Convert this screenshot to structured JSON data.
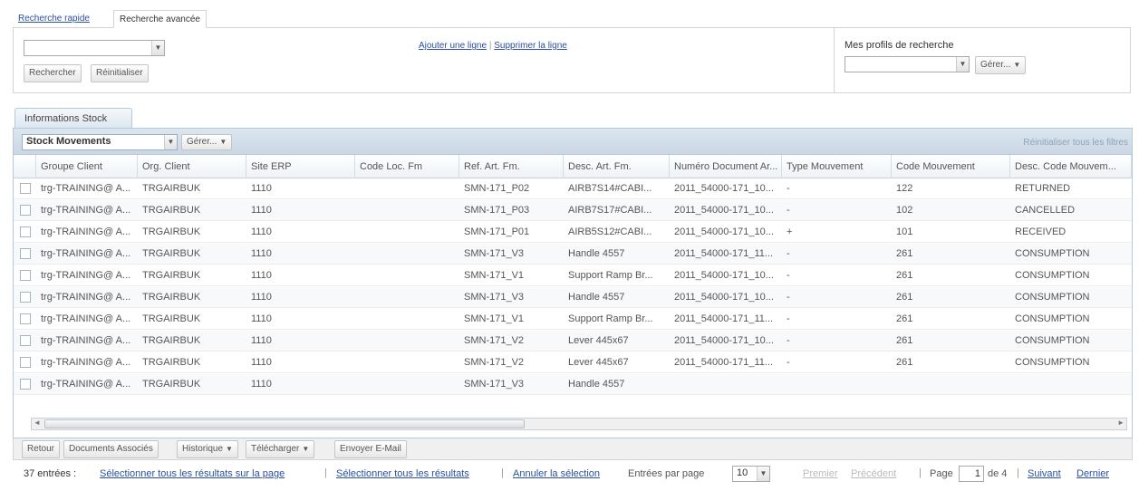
{
  "search_tabs": {
    "quick": "Recherche rapide",
    "advanced": "Recherche avancée"
  },
  "search": {
    "search_button": "Rechercher",
    "reset_button": "Réinitialiser",
    "add_line": "Ajouter une ligne",
    "separator": "|",
    "remove_line": "Supprimer la ligne",
    "profiles_title": "Mes profils de recherche",
    "manage_button": "Gérer..."
  },
  "results": {
    "tab_label": "Informations Stock",
    "view_select": "Stock Movements",
    "manage_button": "Gérer...",
    "reset_filters": "Réinitialiser tous les filtres"
  },
  "table": {
    "columns": [
      "Groupe Client",
      "Org. Client",
      "Site ERP",
      "Code Loc. Fm",
      "Ref. Art. Fm.",
      "Desc. Art. Fm.",
      "Numéro Document Ar...",
      "Type Mouvement",
      "Code Mouvement",
      "Desc. Code Mouvem..."
    ],
    "rows": [
      [
        "trg-TRAINING@ A...",
        "TRGAIRBUK",
        "1110",
        "",
        "SMN-171_P02",
        "AIRB7S14#CABI...",
        "2011_54000-171_10...",
        "-",
        "122",
        "RETURNED"
      ],
      [
        "trg-TRAINING@ A...",
        "TRGAIRBUK",
        "1110",
        "",
        "SMN-171_P03",
        "AIRB7S17#CABI...",
        "2011_54000-171_10...",
        "-",
        "102",
        "CANCELLED"
      ],
      [
        "trg-TRAINING@ A...",
        "TRGAIRBUK",
        "1110",
        "",
        "SMN-171_P01",
        "AIRB5S12#CABI...",
        "2011_54000-171_10...",
        "+",
        "101",
        "RECEIVED"
      ],
      [
        "trg-TRAINING@ A...",
        "TRGAIRBUK",
        "1110",
        "",
        "SMN-171_V3",
        "Handle 4557",
        "2011_54000-171_11...",
        "-",
        "261",
        "CONSUMPTION"
      ],
      [
        "trg-TRAINING@ A...",
        "TRGAIRBUK",
        "1110",
        "",
        "SMN-171_V1",
        "Support Ramp Br...",
        "2011_54000-171_10...",
        "-",
        "261",
        "CONSUMPTION"
      ],
      [
        "trg-TRAINING@ A...",
        "TRGAIRBUK",
        "1110",
        "",
        "SMN-171_V3",
        "Handle 4557",
        "2011_54000-171_10...",
        "-",
        "261",
        "CONSUMPTION"
      ],
      [
        "trg-TRAINING@ A...",
        "TRGAIRBUK",
        "1110",
        "",
        "SMN-171_V1",
        "Support Ramp Br...",
        "2011_54000-171_11...",
        "-",
        "261",
        "CONSUMPTION"
      ],
      [
        "trg-TRAINING@ A...",
        "TRGAIRBUK",
        "1110",
        "",
        "SMN-171_V2",
        "Lever 445x67",
        "2011_54000-171_10...",
        "-",
        "261",
        "CONSUMPTION"
      ],
      [
        "trg-TRAINING@ A...",
        "TRGAIRBUK",
        "1110",
        "",
        "SMN-171_V2",
        "Lever 445x67",
        "2011_54000-171_11...",
        "-",
        "261",
        "CONSUMPTION"
      ],
      [
        "trg-TRAINING@ A...",
        "TRGAIRBUK",
        "1110",
        "",
        "SMN-171_V3",
        "Handle 4557",
        "",
        "",
        "",
        ""
      ]
    ]
  },
  "actions": {
    "back": "Retour",
    "associated_docs": "Documents Associés",
    "history": "Historique",
    "download": "Télécharger",
    "send_email": "Envoyer E-Mail"
  },
  "pager": {
    "entries": "37 entrées :",
    "select_page": "Sélectionner tous les résultats sur la page",
    "select_all": "Sélectionner tous les résultats",
    "cancel_selection": "Annuler la sélection",
    "per_page_label": "Entrées par page",
    "per_page_value": "10",
    "first": "Premier",
    "previous": "Précédent",
    "page_label": "Page",
    "page_value": "1",
    "of_pages": "de 4",
    "next": "Suivant",
    "last": "Dernier"
  }
}
